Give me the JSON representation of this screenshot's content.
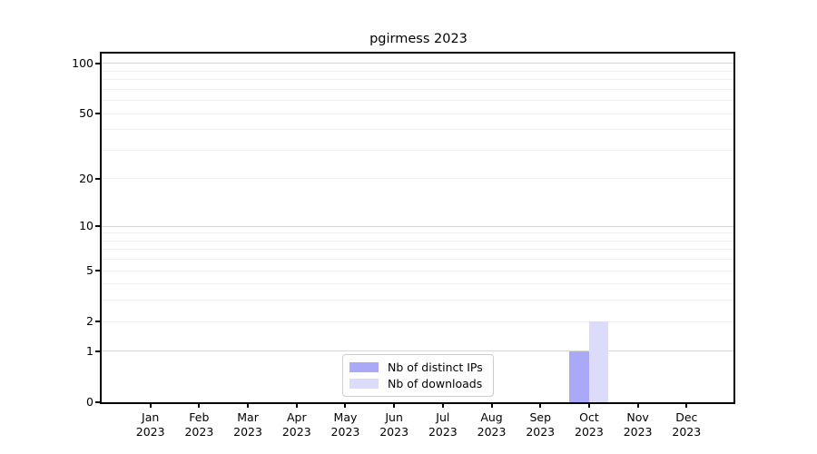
{
  "chart_data": {
    "type": "bar",
    "title": "pgirmess 2023",
    "categories": [
      "Jan",
      "Feb",
      "Mar",
      "Apr",
      "May",
      "Jun",
      "Jul",
      "Aug",
      "Sep",
      "Oct",
      "Nov",
      "Dec"
    ],
    "x_year": "2023",
    "series": [
      {
        "name": "Nb of distinct IPs",
        "color": "#a9a9f7",
        "values": [
          0,
          0,
          0,
          0,
          0,
          0,
          0,
          0,
          0,
          1,
          0,
          0
        ]
      },
      {
        "name": "Nb of downloads",
        "color": "#dcdcfa",
        "values": [
          0,
          0,
          0,
          0,
          0,
          0,
          0,
          0,
          0,
          2,
          0,
          0
        ]
      }
    ],
    "y_ticks": [
      0,
      1,
      2,
      5,
      10,
      20,
      50,
      100
    ],
    "ylim": [
      0,
      114.5
    ],
    "scale": "log1p",
    "grid": true,
    "grid_minor_values": [
      2,
      3,
      4,
      5,
      6,
      7,
      8,
      9,
      20,
      30,
      40,
      50,
      60,
      70,
      80,
      90
    ],
    "grid_major_values": [
      1,
      10,
      100
    ],
    "legend_position": "lower center",
    "colors": {
      "axis": "#000000",
      "grid_minor": "#efefef",
      "grid_major": "#d7d7d7",
      "legend_border": "#cccccc"
    }
  }
}
